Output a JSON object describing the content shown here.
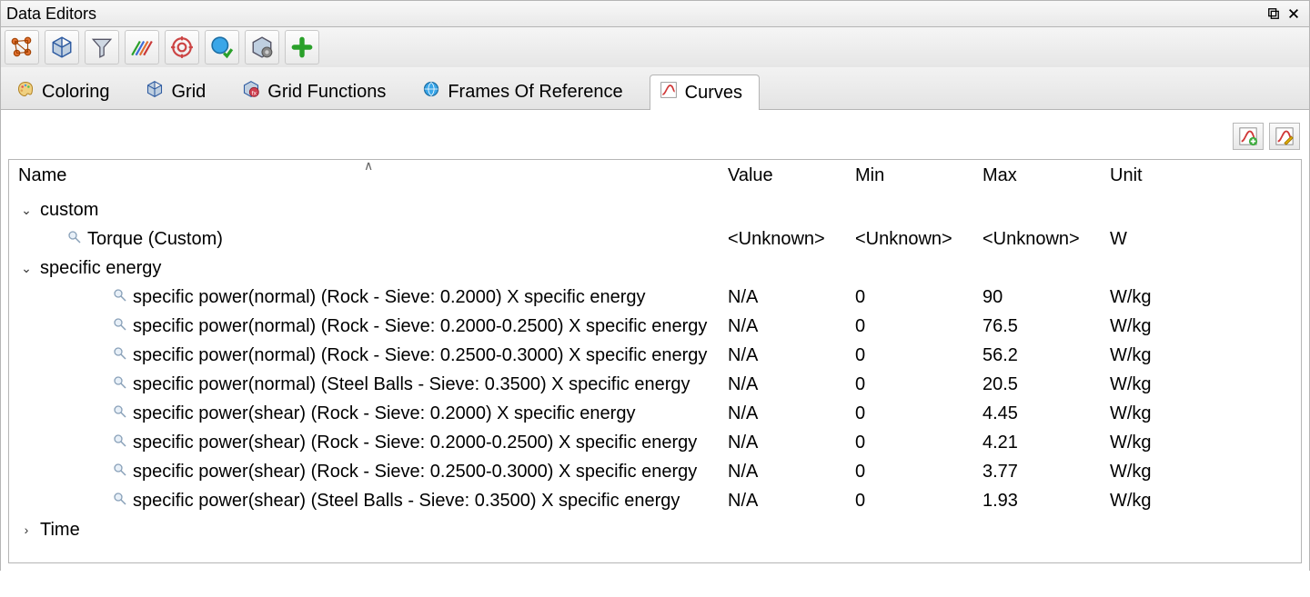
{
  "window": {
    "title": "Data Editors"
  },
  "tabs": [
    {
      "label": "Coloring",
      "icon": "palette-icon",
      "active": false
    },
    {
      "label": "Grid",
      "icon": "cube-icon",
      "active": false
    },
    {
      "label": "Grid Functions",
      "icon": "grid-func-icon",
      "active": false
    },
    {
      "label": "Frames Of Reference",
      "icon": "globe-blue-icon",
      "active": false
    },
    {
      "label": "Curves",
      "icon": "curve-icon",
      "active": true
    }
  ],
  "columns": {
    "name": "Name",
    "value": "Value",
    "min": "Min",
    "max": "Max",
    "unit": "Unit"
  },
  "tree": [
    {
      "type": "group",
      "expanded": true,
      "name": "custom",
      "children": [
        {
          "type": "leaf",
          "name": "Torque (Custom)",
          "value": "<Unknown>",
          "min": "<Unknown>",
          "max": "<Unknown>",
          "unit": "W"
        }
      ]
    },
    {
      "type": "group",
      "expanded": true,
      "name": "specific energy",
      "children": [
        {
          "type": "leaf",
          "name": "specific power(normal) (Rock - Sieve: 0.2000) X specific energy",
          "value": "N/A",
          "min": "0",
          "max": "90",
          "unit": "W/kg"
        },
        {
          "type": "leaf",
          "name": "specific power(normal) (Rock - Sieve: 0.2000-0.2500) X specific energy",
          "value": "N/A",
          "min": "0",
          "max": "76.5",
          "unit": "W/kg"
        },
        {
          "type": "leaf",
          "name": "specific power(normal) (Rock - Sieve: 0.2500-0.3000) X specific energy",
          "value": "N/A",
          "min": "0",
          "max": "56.2",
          "unit": "W/kg"
        },
        {
          "type": "leaf",
          "name": "specific power(normal) (Steel Balls - Sieve: 0.3500) X specific energy",
          "value": "N/A",
          "min": "0",
          "max": "20.5",
          "unit": "W/kg"
        },
        {
          "type": "leaf",
          "name": "specific power(shear) (Rock - Sieve: 0.2000) X specific energy",
          "value": "N/A",
          "min": "0",
          "max": "4.45",
          "unit": "W/kg"
        },
        {
          "type": "leaf",
          "name": "specific power(shear) (Rock - Sieve: 0.2000-0.2500) X specific energy",
          "value": "N/A",
          "min": "0",
          "max": "4.21",
          "unit": "W/kg"
        },
        {
          "type": "leaf",
          "name": "specific power(shear) (Rock - Sieve: 0.2500-0.3000) X specific energy",
          "value": "N/A",
          "min": "0",
          "max": "3.77",
          "unit": "W/kg"
        },
        {
          "type": "leaf",
          "name": "specific power(shear) (Steel Balls - Sieve: 0.3500) X specific energy",
          "value": "N/A",
          "min": "0",
          "max": "1.93",
          "unit": "W/kg"
        }
      ]
    },
    {
      "type": "group",
      "expanded": false,
      "name": "Time",
      "children": []
    }
  ]
}
